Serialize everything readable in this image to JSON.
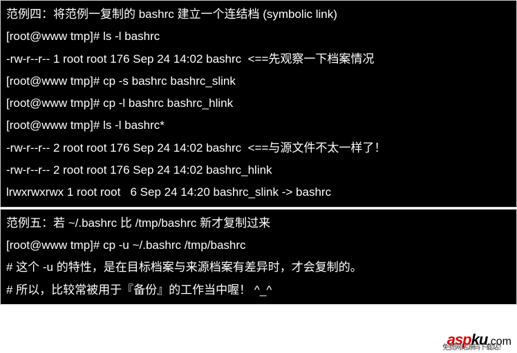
{
  "block1": {
    "lines": [
      "范例四：将范例一复制的 bashrc 建立一个连结档 (symbolic link)",
      "[root@www tmp]# ls -l bashrc",
      "-rw-r--r-- 1 root root 176 Sep 24 14:02 bashrc  <==先观察一下档案情况",
      "[root@www tmp]# cp -s bashrc bashrc_slink",
      "[root@www tmp]# cp -l bashrc bashrc_hlink",
      "[root@www tmp]# ls -l bashrc*",
      "-rw-r--r-- 2 root root 176 Sep 24 14:02 bashrc  <==与源文件不太一样了！",
      "-rw-r--r-- 2 root root 176 Sep 24 14:02 bashrc_hlink",
      "lrwxrwxrwx 1 root root   6 Sep 24 14:20 bashrc_slink -> bashrc"
    ]
  },
  "block2": {
    "lines": [
      "范例五：若 ~/.bashrc 比 /tmp/bashrc 新才复制过来",
      "[root@www tmp]# cp -u ~/.bashrc /tmp/bashrc",
      "# 这个 -u 的特性，是在目标档案与来源档案有差异时，才会复制的。",
      "# 所以，比较常被用于『备份』的工作当中喔！ ^_^"
    ]
  },
  "watermark": {
    "asp": "asp",
    "ku": "ku",
    "dot": ".",
    "com": "com",
    "tagline": "免费网站源码下载站！"
  }
}
